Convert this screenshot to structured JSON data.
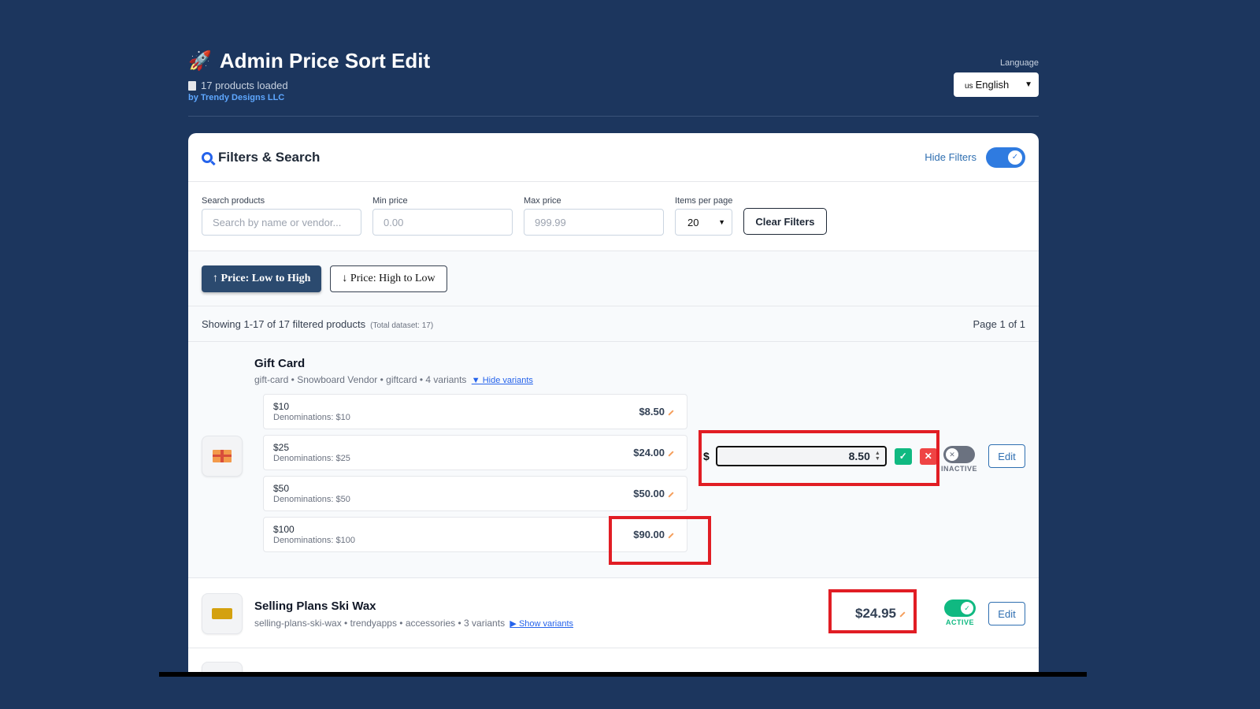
{
  "header": {
    "icon": "rocket-icon",
    "title": "Admin Price Sort Edit",
    "products_loaded": "17 products loaded",
    "byline": "by Trendy Designs LLC",
    "language_label": "Language",
    "language_flag": "us",
    "language_value": "English"
  },
  "filters": {
    "title": "Filters & Search",
    "hide_label": "Hide Filters",
    "toggle_on": true,
    "search_label": "Search products",
    "search_placeholder": "Search by name or vendor...",
    "min_label": "Min price",
    "min_placeholder": "0.00",
    "max_label": "Max price",
    "max_placeholder": "999.99",
    "per_page_label": "Items per page",
    "per_page_value": "20",
    "clear_label": "Clear Filters"
  },
  "sort": {
    "low_high": "↑ Price: Low to High",
    "high_low": "↓ Price: High to Low"
  },
  "summary": {
    "showing": "Showing 1-17 of 17 filtered products",
    "total": "(Total dataset: 17)",
    "page": "Page 1 of 1"
  },
  "products": [
    {
      "name": "Gift Card",
      "meta": "gift-card • Snowboard Vendor • giftcard • 4 variants",
      "variants_link": "▼ Hide variants",
      "variants": [
        {
          "title": "$10",
          "sub": "Denominations: $10",
          "price": "$8.50"
        },
        {
          "title": "$25",
          "sub": "Denominations: $25",
          "price": "$24.00"
        },
        {
          "title": "$50",
          "sub": "Denominations: $50",
          "price": "$50.00"
        },
        {
          "title": "$100",
          "sub": "Denominations: $100",
          "price": "$90.00"
        }
      ],
      "edit_currency": "$",
      "edit_value": "8.50",
      "status": "INACTIVE",
      "edit_label": "Edit"
    },
    {
      "name": "Selling Plans Ski Wax",
      "meta": "selling-plans-ski-wax • trendyapps • accessories • 3 variants",
      "variants_link": "▶ Show variants",
      "price": "$24.95",
      "status": "ACTIVE",
      "edit_label": "Edit"
    }
  ],
  "colors": {
    "background": "#1c365e",
    "accent": "#2f7be0",
    "active": "#10b981",
    "cancel": "#ef4444",
    "highlight": "#e11d24"
  }
}
